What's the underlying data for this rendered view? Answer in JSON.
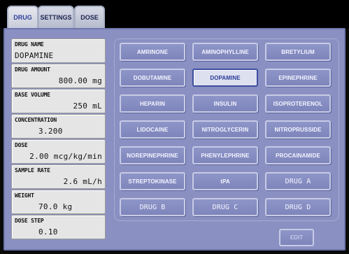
{
  "tabs": [
    {
      "label": "DRUG",
      "active": true
    },
    {
      "label": "SETTINGS",
      "active": false
    },
    {
      "label": "DOSE",
      "active": false
    }
  ],
  "fields": [
    {
      "label": "DRUG NAME",
      "value": "DOPAMINE"
    },
    {
      "label": "DRUG AMOUNT",
      "value": "800.00 mg"
    },
    {
      "label": "BASE VOLUME",
      "value": "250 mL"
    },
    {
      "label": "CONCENTRATION",
      "value": "3.200"
    },
    {
      "label": "DOSE",
      "value": "2.00 mcg/kg/min"
    },
    {
      "label": "SAMPLE RATE",
      "value": "2.6 mL/h"
    },
    {
      "label": "WEIGHT",
      "value": "70.0 kg"
    },
    {
      "label": "DOSE STEP",
      "value": "0.10"
    }
  ],
  "drugs": [
    "AMRINONE",
    "AMINOPHYLLINE",
    "BRETYLIUM",
    "DOBUTAMINE",
    "DOPAMINE",
    "EPINEPHRINE",
    "HEPARIN",
    "INSULIN",
    "ISOPROTERENOL",
    "LIDOCAINE",
    "NITROGLYCERIN",
    "NITROPRUSSIDE",
    "NOREPINEPHRINE",
    "PHENYLEPHRINE",
    "PROCAINAMIDE",
    "STREPTOKINASE",
    "tPA",
    "DRUG A",
    "DRUG B",
    "DRUG C",
    "DRUG D"
  ],
  "selected_drug": "DOPAMINE",
  "edit_label": "EDIT",
  "colors": {
    "panel": "#8a90c2",
    "button": "#8189bf",
    "selected_button": "#dde0ef",
    "selected_text": "#2c3c9a",
    "field_bg": "#e5e5e5"
  }
}
